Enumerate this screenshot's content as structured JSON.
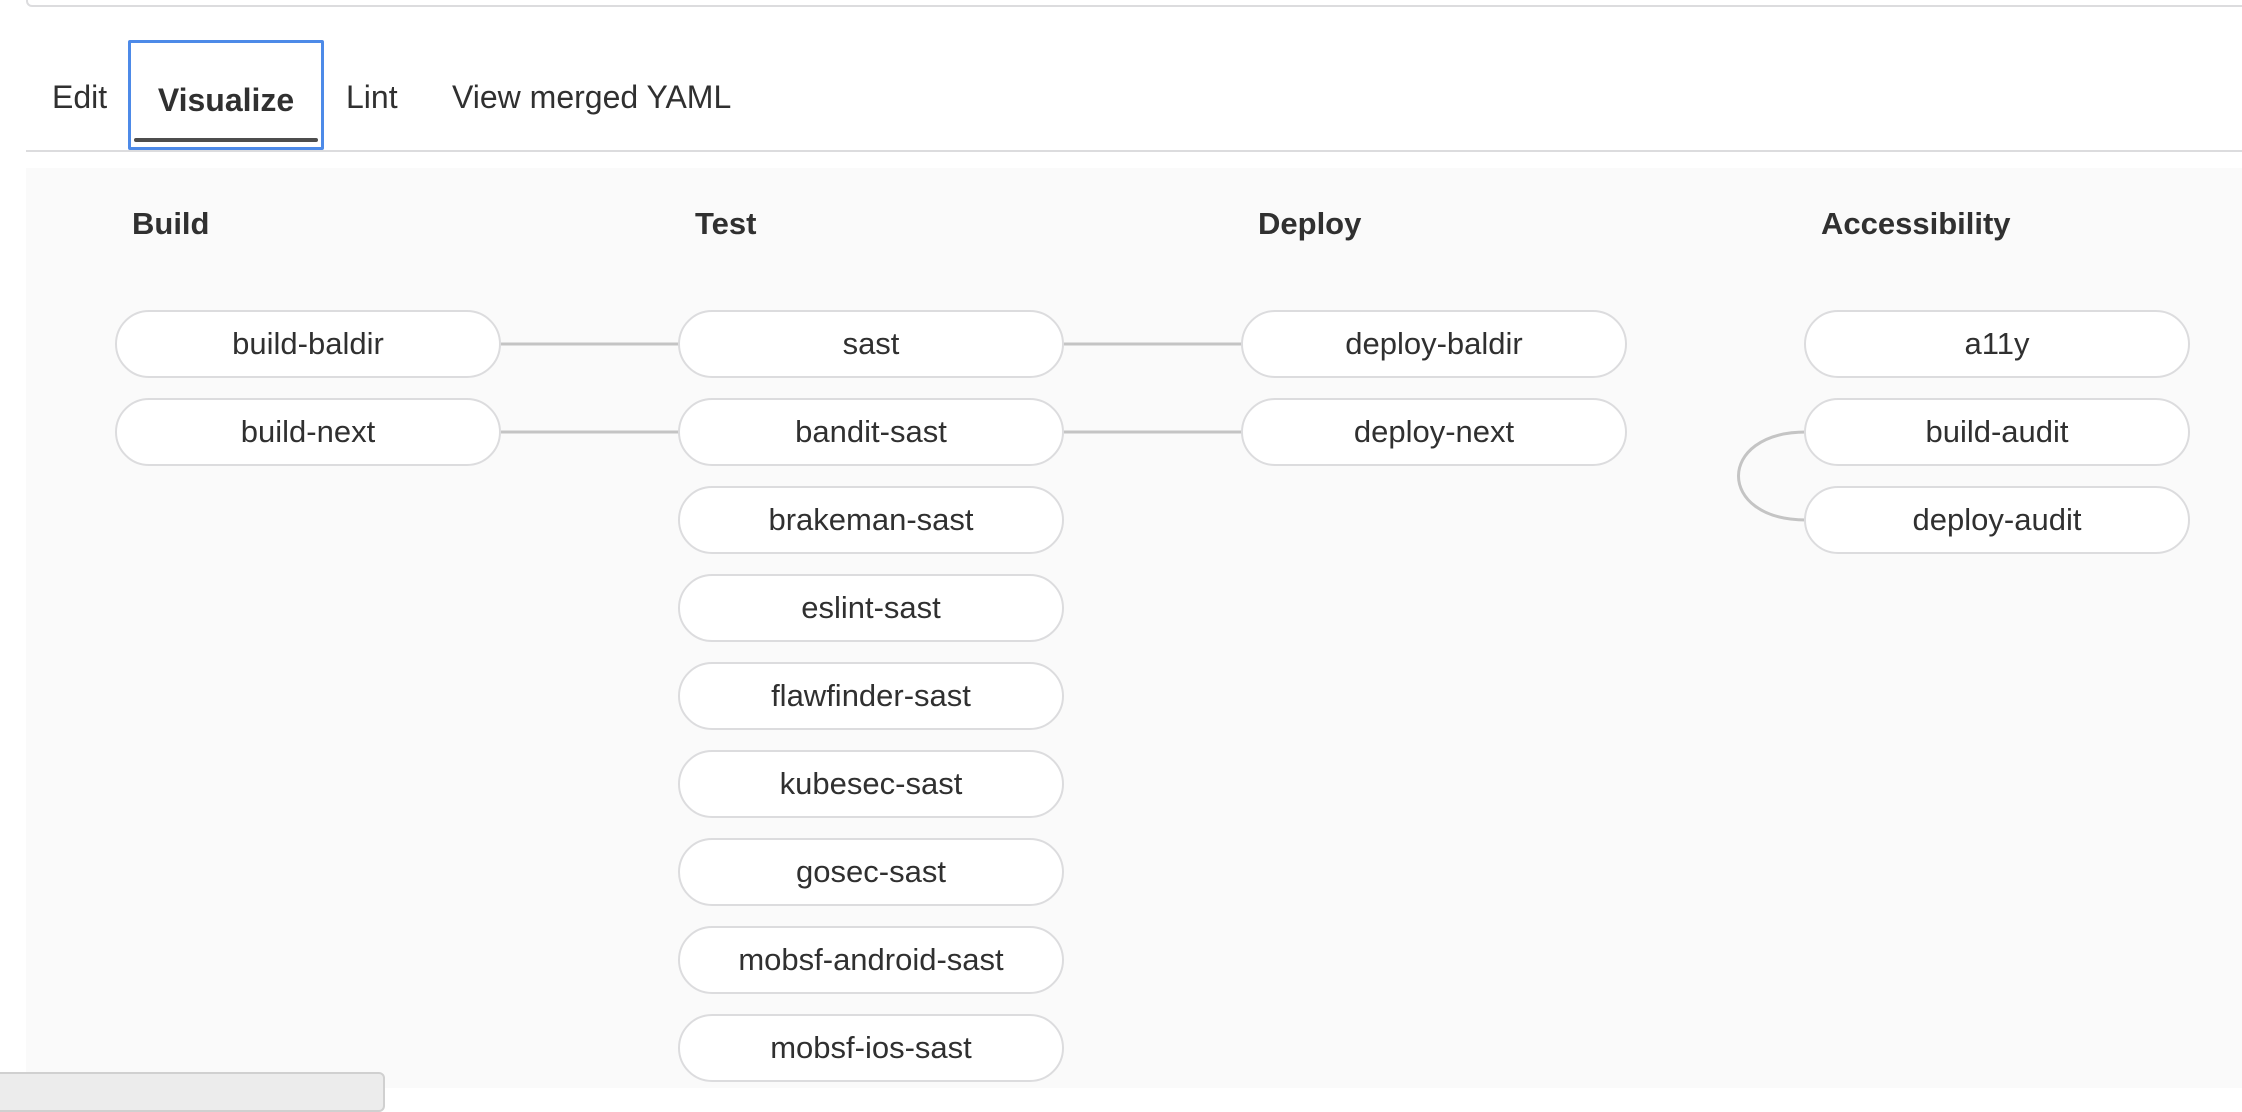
{
  "tabs": {
    "edit": "Edit",
    "visualize": "Visualize",
    "lint": "Lint",
    "merged_yaml": "View merged YAML"
  },
  "stages": {
    "build": {
      "title": "Build",
      "jobs": [
        "build-baldir",
        "build-next"
      ]
    },
    "test": {
      "title": "Test",
      "jobs": [
        "sast",
        "bandit-sast",
        "brakeman-sast",
        "eslint-sast",
        "flawfinder-sast",
        "kubesec-sast",
        "gosec-sast",
        "mobsf-android-sast",
        "mobsf-ios-sast"
      ]
    },
    "deploy": {
      "title": "Deploy",
      "jobs": [
        "deploy-baldir",
        "deploy-next"
      ]
    },
    "accessibility": {
      "title": "Accessibility",
      "jobs": [
        "a11y",
        "build-audit",
        "deploy-audit"
      ]
    }
  },
  "needs_links": [
    {
      "from": "build-baldir",
      "to": "sast"
    },
    {
      "from": "build-next",
      "to": "bandit-sast"
    },
    {
      "from": "sast",
      "to": "deploy-baldir"
    },
    {
      "from": "bandit-sast",
      "to": "deploy-next"
    },
    {
      "from": "build-audit",
      "to": "deploy-audit"
    }
  ],
  "colors": {
    "active_tab_focus": "#4d8ae8",
    "link_line": "#c4c4c4",
    "pipeline_background": "#fafafa"
  }
}
